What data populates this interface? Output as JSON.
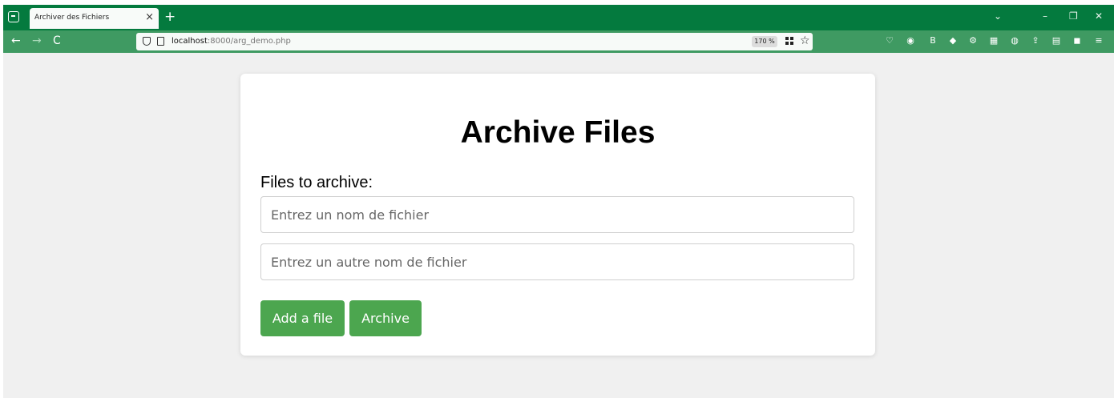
{
  "browser": {
    "tab": {
      "title": "Archiver des Fichiers",
      "close": "×"
    },
    "new_tab": "+",
    "window_controls": {
      "list_tabs": "⌄",
      "minimize": "–",
      "restore": "❐",
      "close": "✕"
    },
    "nav": {
      "back": "←",
      "forward": "→",
      "reload": "C"
    },
    "url": {
      "host": "localhost",
      "rest": ":8000/arg_demo.php"
    },
    "zoom": "170 %",
    "bookmark_icon": "☆",
    "extensions": [
      "pocket-icon",
      "account-icon",
      "burp-icon",
      "extension-diamond-icon",
      "extension-gear-icon",
      "extension-grid-icon",
      "extension-circle-icon",
      "share-icon",
      "reader-icon",
      "ublock-icon",
      "menu-icon"
    ],
    "extension_glyphs": [
      "♡",
      "◉",
      "B",
      "◆",
      "⚙",
      "▦",
      "◍",
      "⇪",
      "▤",
      "◼",
      "≡"
    ],
    "colors": {
      "tabbar": "#047a3e",
      "navbar": "#3f9a62"
    }
  },
  "page": {
    "title": "Archive Files",
    "files_label": "Files to archive:",
    "inputs": [
      {
        "value": "",
        "placeholder": "Entrez un nom de fichier"
      },
      {
        "value": "",
        "placeholder": "Entrez un autre nom de fichier"
      }
    ],
    "buttons": {
      "add": "Add a file",
      "archive": "Archive"
    },
    "colors": {
      "button": "#4ca64f",
      "background": "#f0f0f0"
    }
  }
}
